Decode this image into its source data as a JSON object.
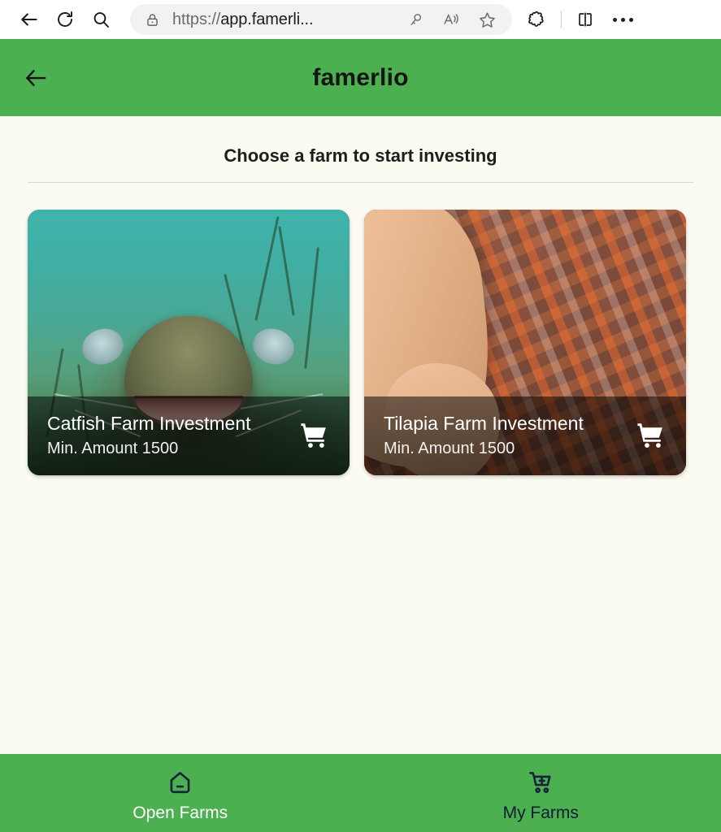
{
  "browser": {
    "back_label": "Back",
    "refresh_label": "Refresh",
    "search_label": "Search",
    "url_scheme": "https://",
    "url_host": "app.famerli...",
    "url_full": "https://app.famerli...",
    "icons": {
      "lock": "site-information-lock-icon",
      "password": "password-key-icon",
      "read_aloud": "read-aloud-icon",
      "favorite": "add-favorite-star-icon",
      "extensions": "extensions-puzzle-icon",
      "split_screen": "split-screen-icon",
      "settings_more": "settings-and-more-icon"
    }
  },
  "app": {
    "header": {
      "title": "famerlio",
      "back_icon": "arrow-left-icon",
      "bar_color": "#4CAF50"
    },
    "page_background": "#fbfbf2",
    "section_title": "Choose a farm to start investing",
    "cards": [
      {
        "title": "Catfish Farm Investment",
        "subtitle": "Min. Amount 1500",
        "cart_icon": "shopping-cart-icon",
        "image_alt": "catfish-underwater-photo"
      },
      {
        "title": "Tilapia Farm Investment",
        "subtitle": "Min. Amount 1500",
        "cart_icon": "shopping-cart-icon",
        "image_alt": "tilapia-fish-pond-photo"
      }
    ],
    "bottom_nav": {
      "items": [
        {
          "label": "Open Farms",
          "icon": "home-icon",
          "active": true,
          "text_color": "#ffffff"
        },
        {
          "label": "My Farms",
          "icon": "cart-plus-icon",
          "active": false,
          "text_color": "#101c33"
        }
      ]
    }
  }
}
